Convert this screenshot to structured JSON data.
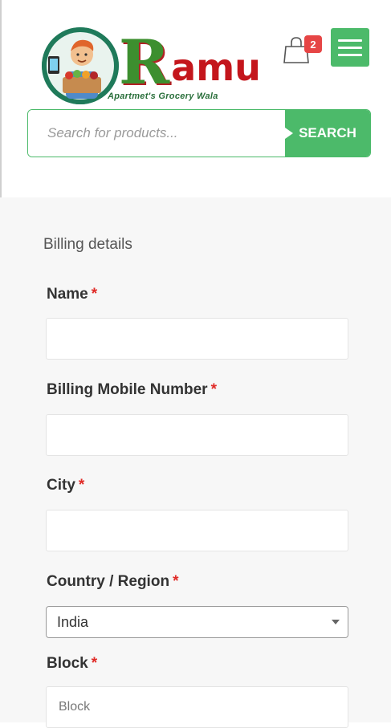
{
  "header": {
    "logo": {
      "title": "Ramu",
      "title_first_letter": "R",
      "title_rest": "amu",
      "tagline": "Apartmet's Grocery Wala"
    },
    "cart": {
      "count": "2",
      "icon": "shopping-bag-icon"
    },
    "menu": {
      "icon": "hamburger-menu-icon"
    }
  },
  "search": {
    "placeholder": "Search for products...",
    "value": "",
    "button_label": "SEARCH"
  },
  "billing": {
    "title": "Billing details",
    "required_marker": "*",
    "fields": {
      "name": {
        "label": "Name",
        "value": ""
      },
      "mobile": {
        "label": "Billing Mobile Number",
        "value": ""
      },
      "city": {
        "label": "City",
        "value": ""
      },
      "country": {
        "label": "Country / Region",
        "selected": "India"
      },
      "block": {
        "label": "Block",
        "placeholder": "Block",
        "value": ""
      }
    }
  },
  "colors": {
    "accent_green": "#4cba6a",
    "required_red": "#e02b27",
    "badge_red": "#e64545"
  }
}
